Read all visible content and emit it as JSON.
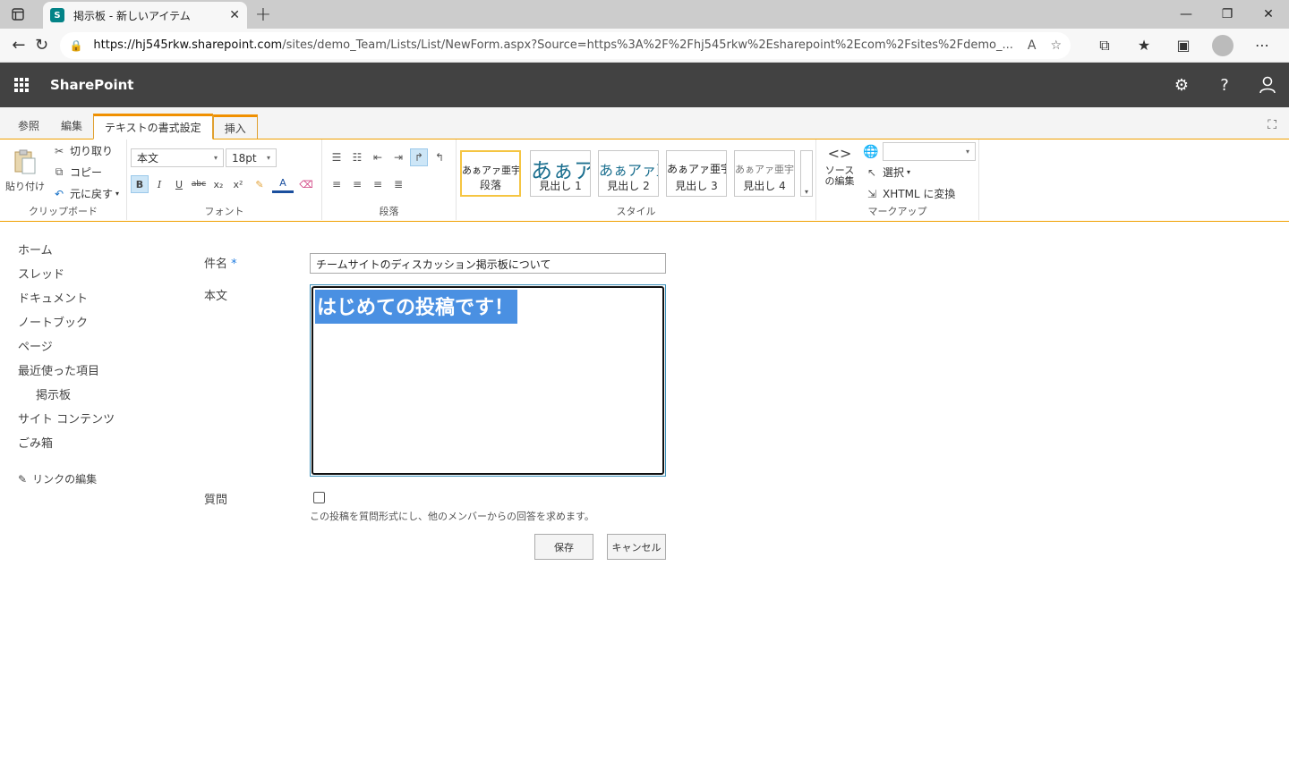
{
  "browser": {
    "tab_title": "掲示板 - 新しいアイテム",
    "favicon_letter": "S",
    "url_host": "https://hj545rkw.sharepoint.com",
    "url_rest": "/sites/demo_Team/Lists/List/NewForm.aspx?Source=https%3A%2F%2Fhj545rkw%2Esharepoint%2Ecom%2Fsites%2Fdemo_...",
    "read_aloud_label": "Aᴬ"
  },
  "suite": {
    "brand": "SharePoint"
  },
  "ribbon": {
    "tabs": [
      "参照",
      "編集",
      "テキストの書式設定",
      "挿入"
    ],
    "clipboard": {
      "paste": "貼り付け",
      "cut": "切り取り",
      "copy": "コピー",
      "undo": "元に戻す",
      "group": "クリップボード"
    },
    "font": {
      "family": "本文",
      "size": "18pt",
      "group": "フォント",
      "bold": "B",
      "italic": "I",
      "underline": "U",
      "strike": "abc",
      "sub": "x₂",
      "sup": "x²",
      "color_letter": "A"
    },
    "paragraph": {
      "group": "段落"
    },
    "styles": {
      "group": "スタイル",
      "items": [
        {
          "sample": "あぁアァ亜宇",
          "label": "段落"
        },
        {
          "sample": "あぁア",
          "label": "見出し 1"
        },
        {
          "sample": "あぁアァ亜",
          "label": "見出し 2"
        },
        {
          "sample": "あぁアァ亜宇",
          "label": "見出し 3"
        },
        {
          "sample": "あぁアァ亜宇",
          "label": "見出し 4"
        }
      ]
    },
    "markup": {
      "group": "マークアップ",
      "source": "ソースの編集",
      "select": "選択",
      "xhtml": "XHTML に変換"
    }
  },
  "nav": {
    "items": [
      "ホーム",
      "スレッド",
      "ドキュメント",
      "ノートブック",
      "ページ",
      "最近使った項目",
      "掲示板",
      "サイト コンテンツ",
      "ごみ箱"
    ],
    "edit_links": "リンクの編集"
  },
  "form": {
    "subject_label": "件名",
    "required_mark": "*",
    "subject_value": "チームサイトのディスカッション掲示板について",
    "body_label": "本文",
    "body_value": "はじめての投稿です！",
    "question_label": "質問",
    "question_hint": "この投稿を質問形式にし、他のメンバーからの回答を求めます。",
    "question_checked": false,
    "save": "保存",
    "cancel": "キャンセル"
  }
}
